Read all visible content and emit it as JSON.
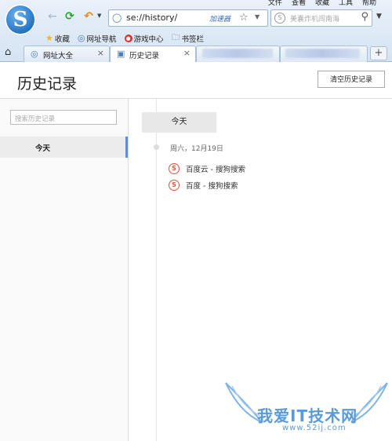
{
  "browser": {
    "menu": [
      "文件",
      "查看",
      "收藏",
      "工具",
      "帮助"
    ],
    "address": {
      "url": "se://history/",
      "accelerator_label": "加速器"
    },
    "search": {
      "placeholder": "美囊炸机闯南海"
    },
    "bookmarks": [
      {
        "icon": "star-icon",
        "label": "收藏"
      },
      {
        "icon": "globe-icon",
        "label": "网址导航"
      },
      {
        "icon": "game-icon",
        "label": "游戏中心"
      },
      {
        "icon": "folder-icon",
        "label": "书签栏"
      }
    ],
    "tabs": [
      {
        "icon": "globe-icon",
        "label": "网址大全"
      },
      {
        "icon": "history-icon",
        "label": "历史记录",
        "active": true
      }
    ]
  },
  "page": {
    "title": "历史记录",
    "clear_button": "清空历史记录"
  },
  "sidebar": {
    "search_placeholder": "搜索历史记录",
    "items": [
      {
        "label": "今天",
        "selected": true
      }
    ]
  },
  "timeline": {
    "group_label": "今天",
    "date": "周六，12月19日",
    "entries": [
      {
        "icon": "sogou-icon",
        "title": "百度云 - 搜狗搜索"
      },
      {
        "icon": "sogou-icon",
        "title": "百度 - 搜狗搜索"
      }
    ]
  },
  "watermark": {
    "text": "我爱IT技术网",
    "url": "www.52ij.com"
  },
  "colors": {
    "accent": "#5e8fd4",
    "sogou": "#e0503c"
  }
}
